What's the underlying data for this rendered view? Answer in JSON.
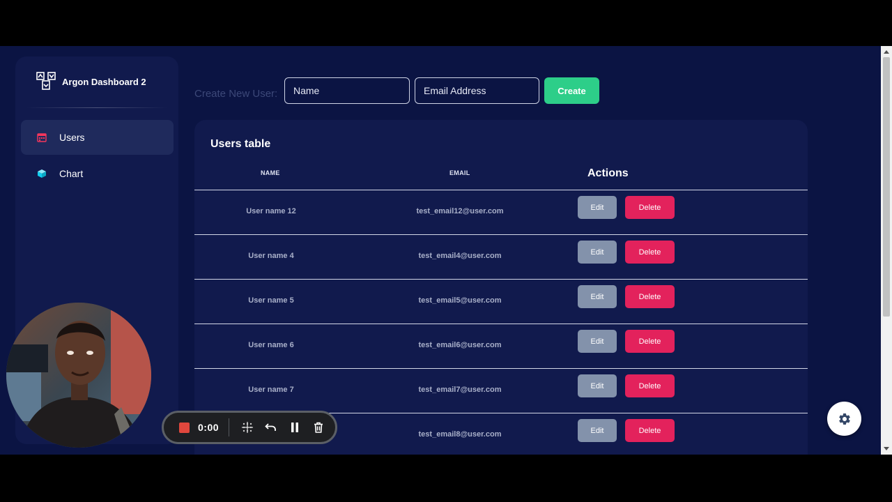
{
  "sidebar": {
    "brand": "Argon Dashboard 2",
    "items": [
      {
        "label": "Users",
        "icon": "calendar-icon",
        "active": true,
        "icon_color": "#f5365c"
      },
      {
        "label": "Chart",
        "icon": "cube-icon",
        "active": false,
        "icon_color": "#11cdef"
      }
    ]
  },
  "create": {
    "label": "Create New User:",
    "name_placeholder": "Name",
    "email_placeholder": "Email Address",
    "button": "Create"
  },
  "table": {
    "title": "Users table",
    "columns": {
      "name": "Name",
      "email": "Email",
      "actions": "Actions"
    },
    "edit_label": "Edit",
    "delete_label": "Delete",
    "rows": [
      {
        "name": "User name 12",
        "email": "test_email12@user.com"
      },
      {
        "name": "User name 4",
        "email": "test_email4@user.com"
      },
      {
        "name": "User name 5",
        "email": "test_email5@user.com"
      },
      {
        "name": "User name 6",
        "email": "test_email6@user.com"
      },
      {
        "name": "User name 7",
        "email": "test_email7@user.com"
      },
      {
        "name": "",
        "email": "test_email8@user.com"
      }
    ]
  },
  "recorder": {
    "time": "0:00"
  },
  "colors": {
    "background": "#0b1443",
    "card": "#111a4d",
    "create_button": "#2dce89",
    "edit_button": "#8392ab",
    "delete_button": "#e3225c"
  }
}
